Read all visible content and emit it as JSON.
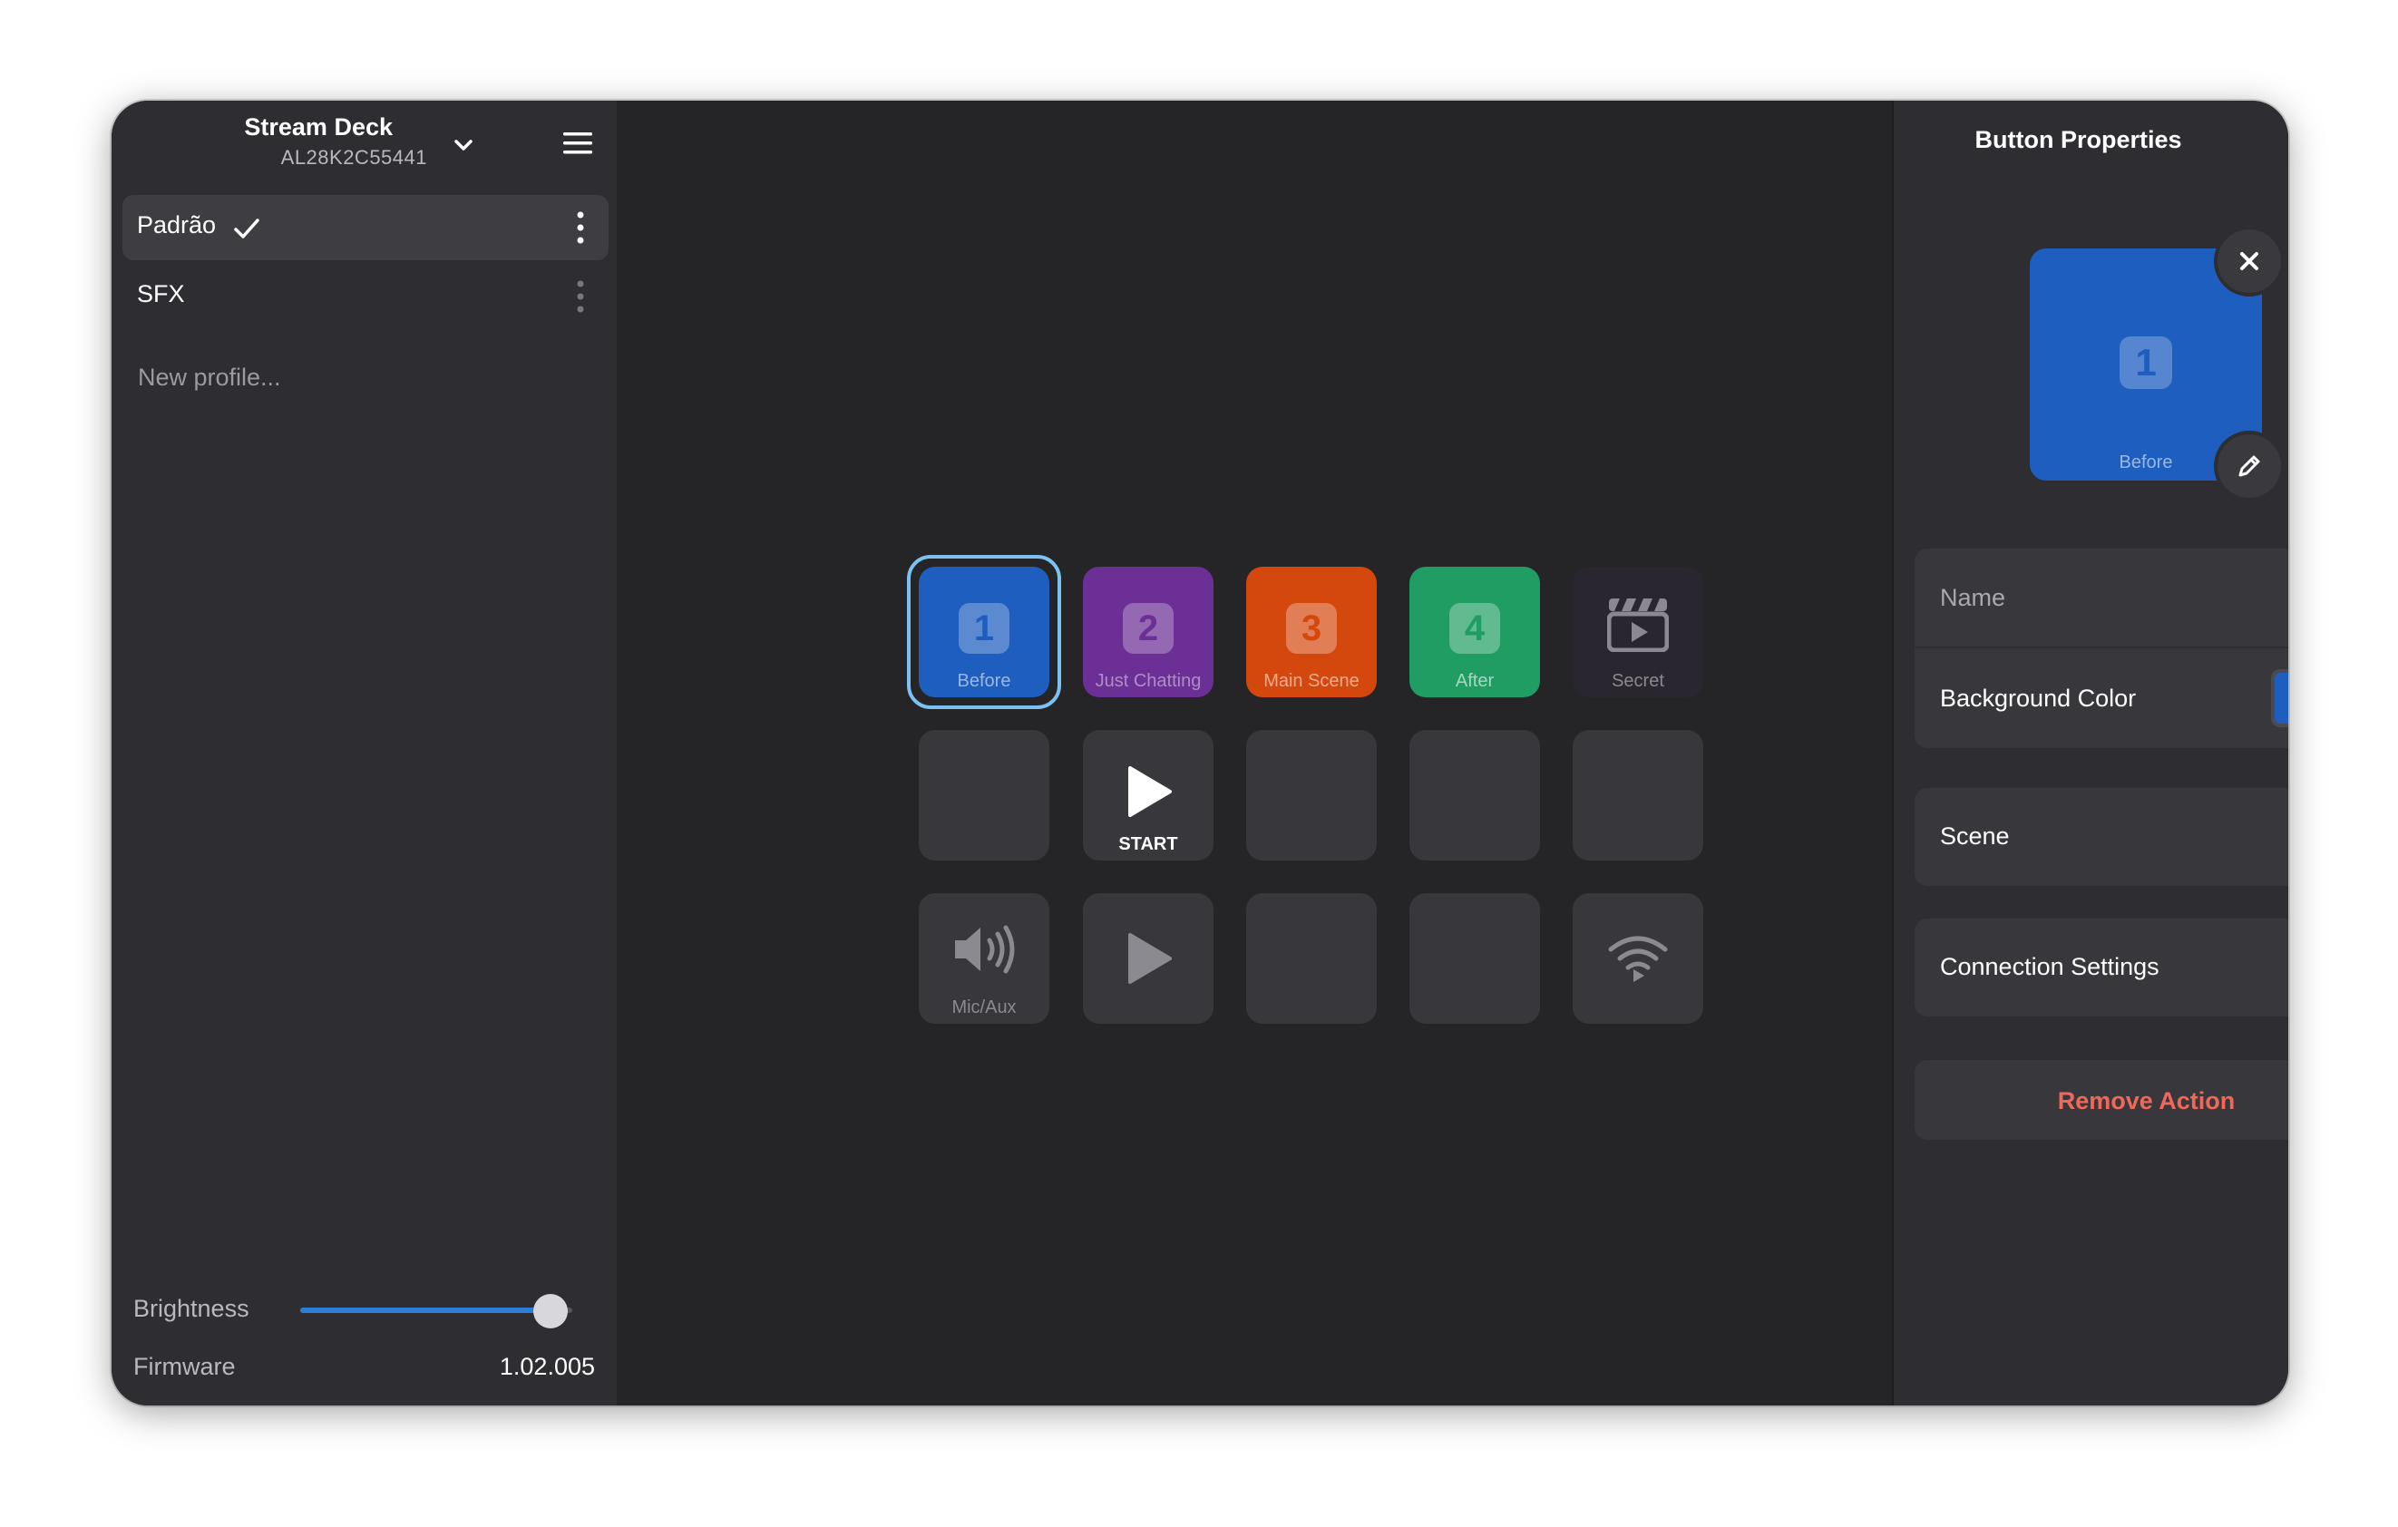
{
  "device": {
    "name": "Stream Deck",
    "serial": "AL28K2C55441"
  },
  "profiles": [
    {
      "label": "Padrão",
      "active": true
    },
    {
      "label": "SFX",
      "active": false
    }
  ],
  "new_profile_placeholder": "New profile...",
  "brightness": {
    "label": "Brightness",
    "value": 0.92
  },
  "firmware": {
    "label": "Firmware",
    "value": "1.02.005"
  },
  "keys": {
    "row1": [
      {
        "number": "1",
        "caption": "Before",
        "color": "#1d5ebf"
      },
      {
        "number": "2",
        "caption": "Just Chatting",
        "color": "#6b2f96"
      },
      {
        "number": "3",
        "caption": "Main Scene",
        "color": "#d4470d"
      },
      {
        "number": "4",
        "caption": "After",
        "color": "#1f9d62"
      },
      {
        "number": "",
        "caption": "Secret",
        "color": "#2a2630"
      }
    ],
    "start_caption": "START",
    "mic_caption": "Mic/Aux"
  },
  "properties": {
    "title": "Button Properties",
    "preview_number": "1",
    "preview_caption": "Before",
    "name_placeholder": "Name",
    "background_label": "Background Color",
    "background_color": "#1d5ebf",
    "scene_label": "Scene",
    "connection_label": "Connection Settings",
    "remove_label": "Remove Action"
  }
}
